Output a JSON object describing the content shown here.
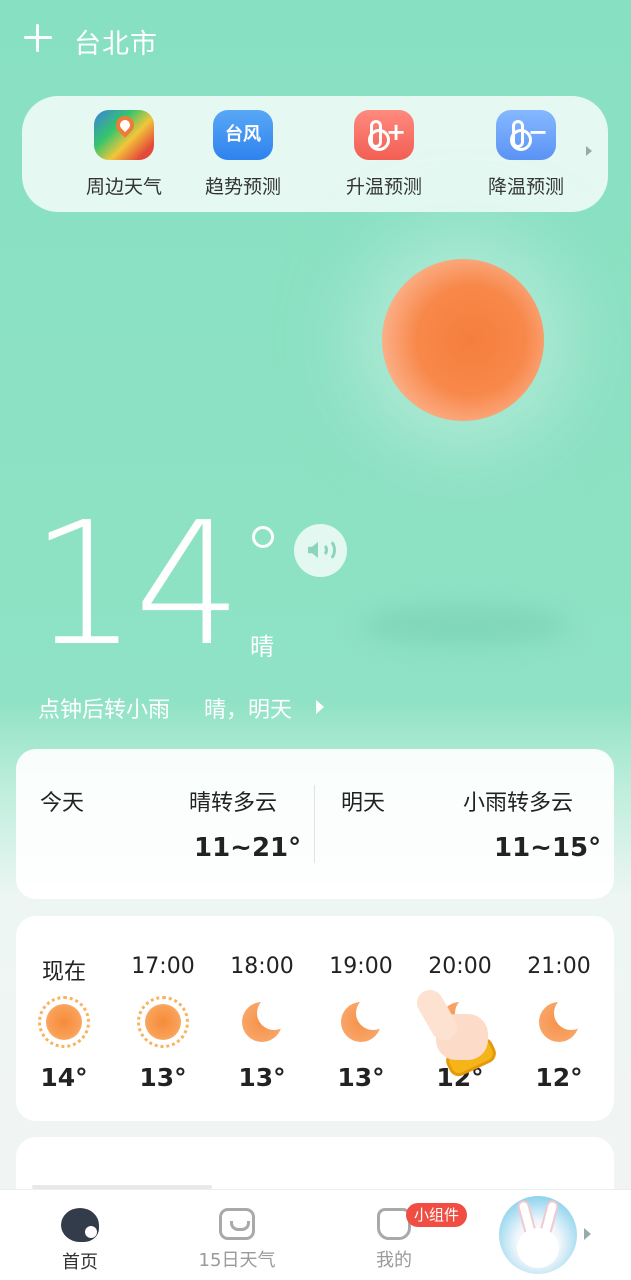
{
  "header": {
    "city": "台北市",
    "add_icon": "plus-icon"
  },
  "tools": [
    {
      "label": "周边天气",
      "icon": "map-pin-icon"
    },
    {
      "label": "趋势预测",
      "icon": "typhoon-icon",
      "icon_text": "台风"
    },
    {
      "label": "升温预测",
      "icon": "thermometer-up-icon",
      "sign": "+"
    },
    {
      "label": "降温预测",
      "icon": "thermometer-down-icon",
      "sign": "−"
    }
  ],
  "current": {
    "temp": "14",
    "condition": "晴",
    "ticker_1": "点钟后转小雨",
    "ticker_2": "晴，明天"
  },
  "days": {
    "today": {
      "label": "今天",
      "desc": "晴转多云",
      "range": "11~21°"
    },
    "tomorrow": {
      "label": "明天",
      "desc": "小雨转多云",
      "range": "11~15°"
    }
  },
  "hourly": [
    {
      "time": "现在",
      "temp": "14°",
      "icon": "sun-icon"
    },
    {
      "time": "17:00",
      "temp": "13°",
      "icon": "sun-icon"
    },
    {
      "time": "18:00",
      "temp": "13°",
      "icon": "moon-icon"
    },
    {
      "time": "19:00",
      "temp": "13°",
      "icon": "moon-icon"
    },
    {
      "time": "20:00",
      "temp": "12°",
      "icon": "moon-icon"
    },
    {
      "time": "21:00",
      "temp": "12°",
      "icon": "moon-icon"
    }
  ],
  "tabbar": {
    "home": "首页",
    "fifteen": "15日天气",
    "me": "我的",
    "badge": "小组件"
  },
  "colors": {
    "background": "#88e0c2",
    "sun": "#f57e3c",
    "badge": "#f04e43"
  }
}
